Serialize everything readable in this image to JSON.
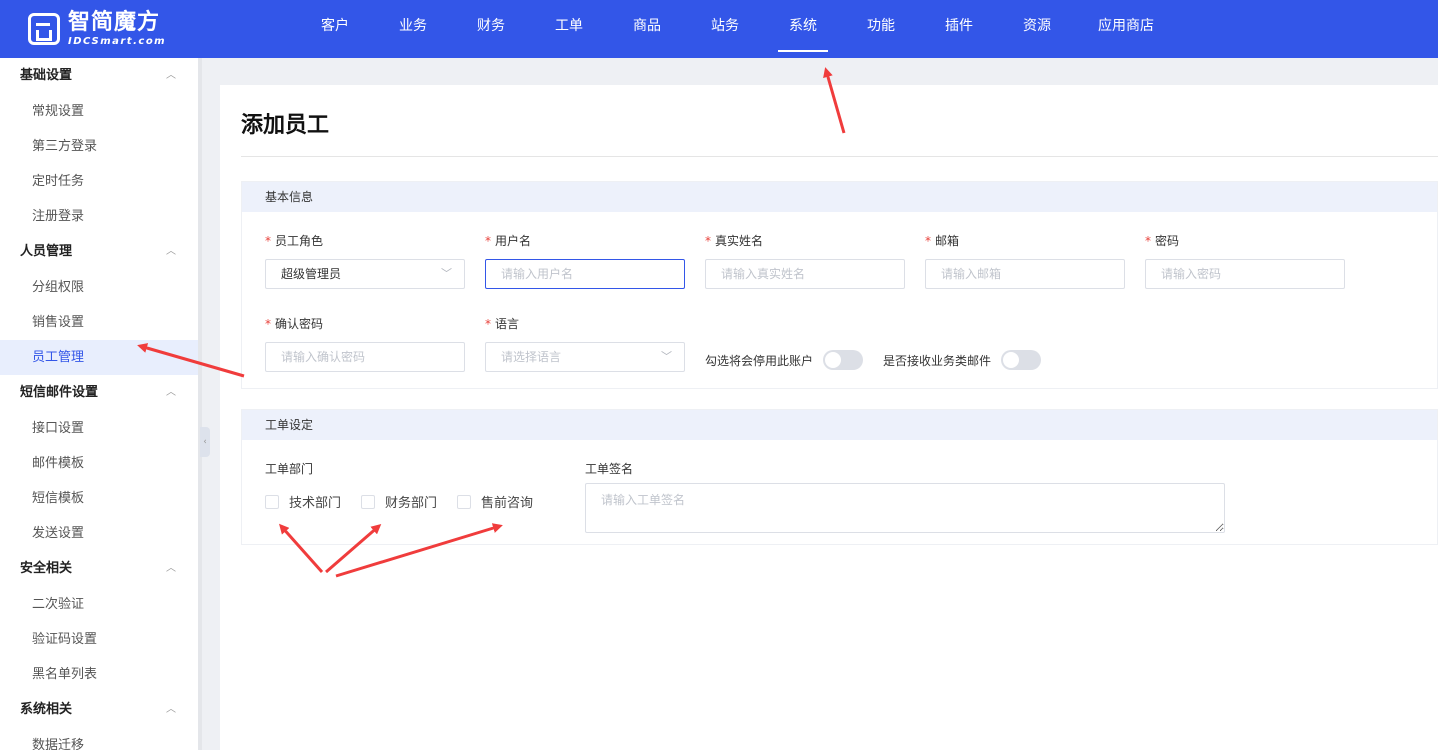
{
  "brand": {
    "name_cn": "智简魔方",
    "name_en": "IDCSmart.com"
  },
  "nav": [
    {
      "label": "客户"
    },
    {
      "label": "业务"
    },
    {
      "label": "财务"
    },
    {
      "label": "工单"
    },
    {
      "label": "商品"
    },
    {
      "label": "站务"
    },
    {
      "label": "系统",
      "active": true
    },
    {
      "label": "功能"
    },
    {
      "label": "插件"
    },
    {
      "label": "资源"
    },
    {
      "label": "应用商店"
    }
  ],
  "sidebar": {
    "groups": [
      {
        "title": "基础设置",
        "items": [
          "常规设置",
          "第三方登录",
          "定时任务",
          "注册登录"
        ]
      },
      {
        "title": "人员管理",
        "items": [
          "分组权限",
          "销售设置",
          "员工管理"
        ]
      },
      {
        "title": "短信邮件设置",
        "items": [
          "接口设置",
          "邮件模板",
          "短信模板",
          "发送设置"
        ]
      },
      {
        "title": "安全相关",
        "items": [
          "二次验证",
          "验证码设置",
          "黑名单列表"
        ]
      },
      {
        "title": "系统相关",
        "items": [
          "数据迁移"
        ]
      }
    ],
    "active_item": "员工管理"
  },
  "page": {
    "title": "添加员工"
  },
  "basic": {
    "section_title": "基本信息",
    "role": {
      "label": "员工角色",
      "value": "超级管理员"
    },
    "username": {
      "label": "用户名",
      "placeholder": "请输入用户名"
    },
    "realname": {
      "label": "真实姓名",
      "placeholder": "请输入真实姓名"
    },
    "email": {
      "label": "邮箱",
      "placeholder": "请输入邮箱"
    },
    "password": {
      "label": "密码",
      "placeholder": "请输入密码"
    },
    "confirm": {
      "label": "确认密码",
      "placeholder": "请输入确认密码"
    },
    "language": {
      "label": "语言",
      "placeholder": "请选择语言"
    },
    "disable_toggle_label": "勾选将会停用此账户",
    "mail_toggle_label": "是否接收业务类邮件"
  },
  "ticket": {
    "section_title": "工单设定",
    "dept_label": "工单部门",
    "departments": [
      "技术部门",
      "财务部门",
      "售前咨询"
    ],
    "signature_label": "工单签名",
    "signature_placeholder": "请输入工单签名"
  },
  "colors": {
    "primary": "#3356e8",
    "annotation_arrow": "#f03c3c"
  }
}
